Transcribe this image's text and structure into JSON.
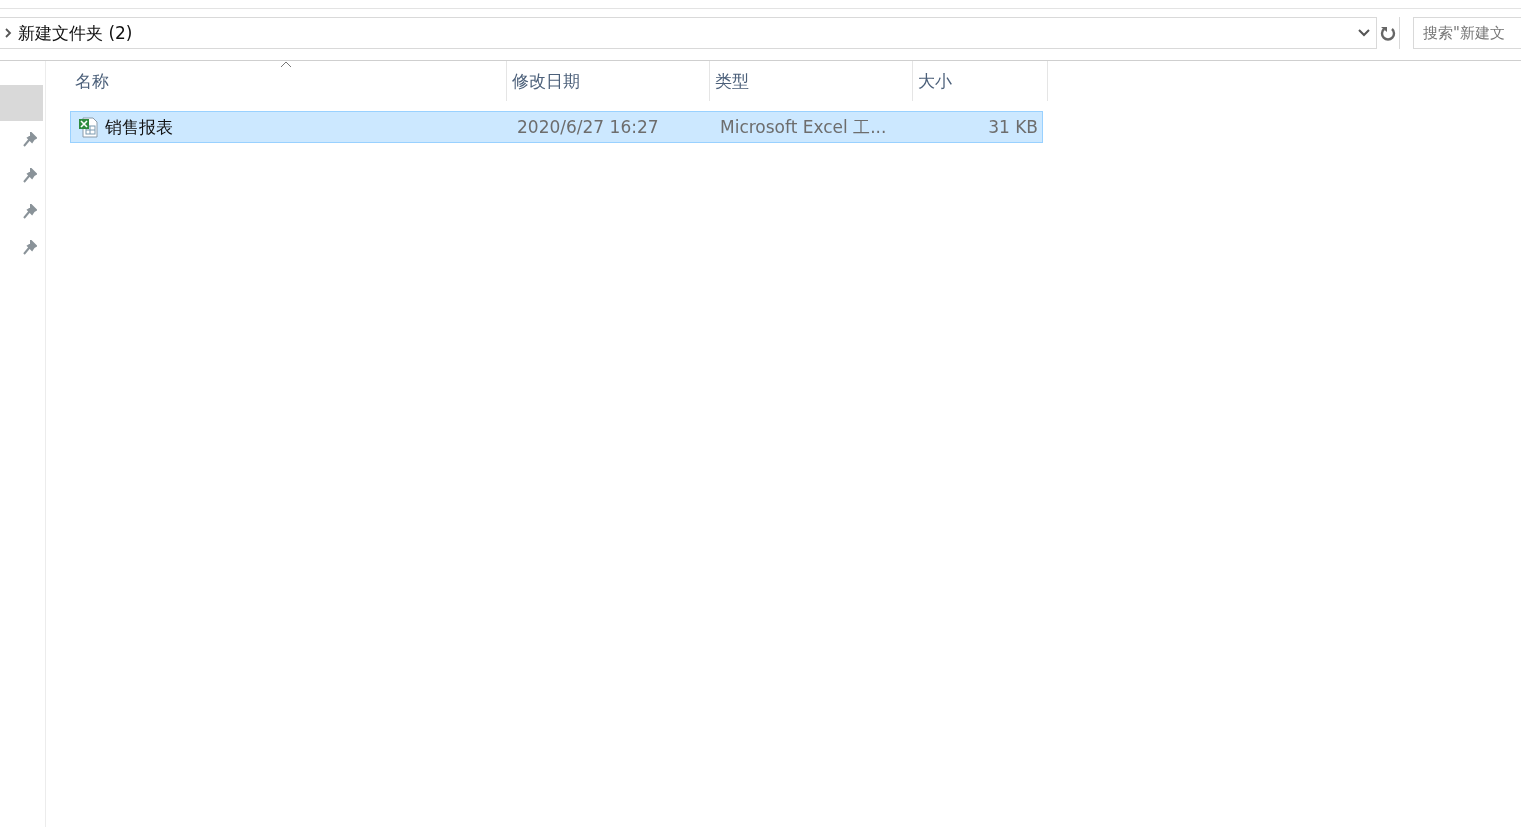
{
  "address_bar": {
    "path": "新建文件夹 (2)",
    "search_placeholder": "搜索\"新建文"
  },
  "sidebar": {
    "items": [
      {
        "selected": true,
        "pinned": false
      },
      {
        "selected": false,
        "pinned": true
      },
      {
        "selected": false,
        "pinned": true
      },
      {
        "selected": false,
        "pinned": true
      },
      {
        "selected": false,
        "pinned": true
      }
    ]
  },
  "file_list": {
    "columns": [
      {
        "label": "名称",
        "sorted": true
      },
      {
        "label": "修改日期",
        "sorted": false
      },
      {
        "label": "类型",
        "sorted": false
      },
      {
        "label": "大小",
        "sorted": false
      }
    ],
    "rows": [
      {
        "kind": "excel",
        "name": "销售报表",
        "modified": "2020/6/27 16:27",
        "type": "Microsoft Excel 工...",
        "size": "31 KB",
        "selected": true
      }
    ]
  }
}
